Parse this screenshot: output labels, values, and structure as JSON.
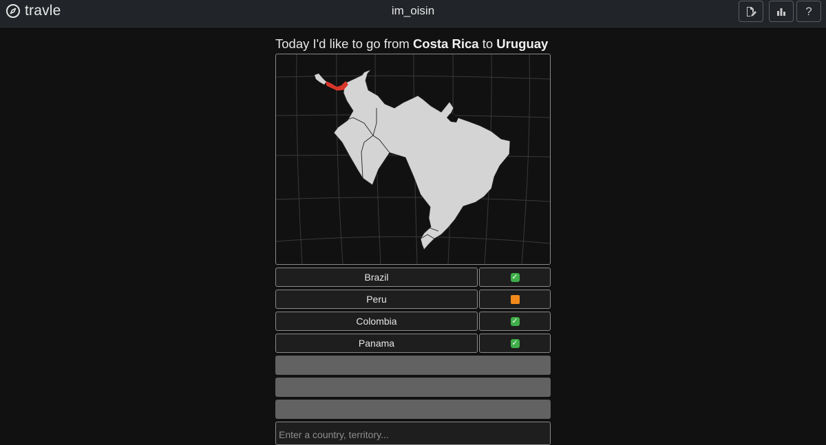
{
  "app": {
    "name": "travle",
    "username": "im_oisin",
    "icons": {
      "logo": "compass-icon",
      "edit": "edit-note-icon",
      "stats": "bar-chart-icon",
      "help": "question-icon"
    },
    "help_label": "?"
  },
  "puzzle": {
    "prefix": "Today I'd like to go from ",
    "from": "Costa Rica",
    "middle": " to ",
    "to": "Uruguay"
  },
  "guesses": [
    {
      "country": "Brazil",
      "result": "correct"
    },
    {
      "country": "Peru",
      "result": "near"
    },
    {
      "country": "Colombia",
      "result": "correct"
    },
    {
      "country": "Panama",
      "result": "correct"
    }
  ],
  "remaining_slots": 3,
  "input": {
    "value": "",
    "placeholder": "Enter a country, territory..."
  },
  "colors": {
    "background": "#111111",
    "topbar": "#212428",
    "land": "#d4d4d4",
    "highlight": "#d9362b",
    "correct": "#3fae49",
    "near": "#f28a1b",
    "empty_slot": "#626262"
  }
}
